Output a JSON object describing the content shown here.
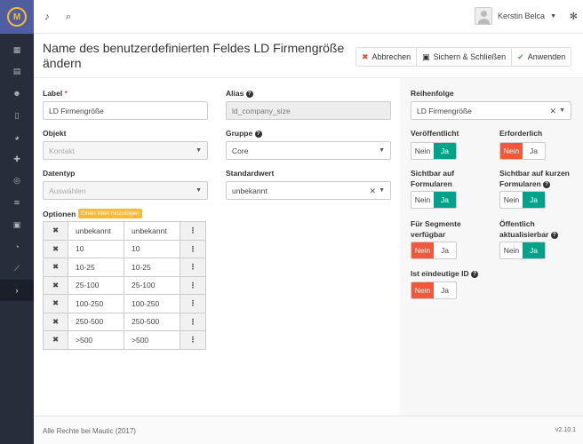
{
  "topbar": {
    "user_name": "Kerstin Belca"
  },
  "header": {
    "title": "Name des benutzerdefinierten Feldes LD Firmengröße ändern",
    "buttons": {
      "cancel": "Abbrechen",
      "save_close": "Sichern & Schließen",
      "apply": "Anwenden"
    }
  },
  "form": {
    "label": {
      "title": "Label",
      "value": "LD Firmengröße"
    },
    "alias": {
      "title": "Alias",
      "value": "ld_company_size"
    },
    "object": {
      "title": "Objekt",
      "value": "Kontakt"
    },
    "group": {
      "title": "Gruppe",
      "value": "Core"
    },
    "datatype": {
      "title": "Datentyp",
      "value": "Auswählen"
    },
    "default": {
      "title": "Standardwert",
      "value": "unbekannt"
    },
    "options_title": "Optionen",
    "add_value": "Einen Wert hinzufügen",
    "options": [
      {
        "label": "unbekannt",
        "value": "unbekannt"
      },
      {
        "label": "10",
        "value": "10"
      },
      {
        "label": "10-25",
        "value": "10-25"
      },
      {
        "label": "25-100",
        "value": "25-100"
      },
      {
        "label": "100-250",
        "value": "100-250"
      },
      {
        "label": "250-500",
        "value": "250-500"
      },
      {
        "label": ">500",
        "value": ">500"
      }
    ]
  },
  "right": {
    "order": {
      "title": "Reihenfolge",
      "value": "LD Firmengröße"
    },
    "published": {
      "title": "Veröffentlicht",
      "selected": "yes"
    },
    "required": {
      "title": "Erforderlich",
      "selected": "no"
    },
    "visible_forms": {
      "title_1": "Sichtbar auf",
      "title_2": "Formularen",
      "selected": "yes"
    },
    "visible_short_forms": {
      "title_1": "Sichtbar auf kurzen",
      "title_2": "Formularen",
      "selected": "yes"
    },
    "segments": {
      "title_1": "Für Segmente",
      "title_2": "verfügbar",
      "selected": "no"
    },
    "public_update": {
      "title_1": "Öffentlich",
      "title_2": "aktualisierbar",
      "selected": "yes"
    },
    "unique_id": {
      "title": "Ist eindeutige ID",
      "selected": "no"
    },
    "no_label": "Nein",
    "yes_label": "Ja"
  },
  "footer": {
    "copyright": "Alle Rechte bei Mautic (2017)",
    "version": "v2.10.1"
  },
  "colors": {
    "sidebar": "#282d3b",
    "logo_bg": "#4e5e9e",
    "no_active": "#f4573a",
    "yes_active": "#00a28a",
    "badge": "#fdb933"
  }
}
